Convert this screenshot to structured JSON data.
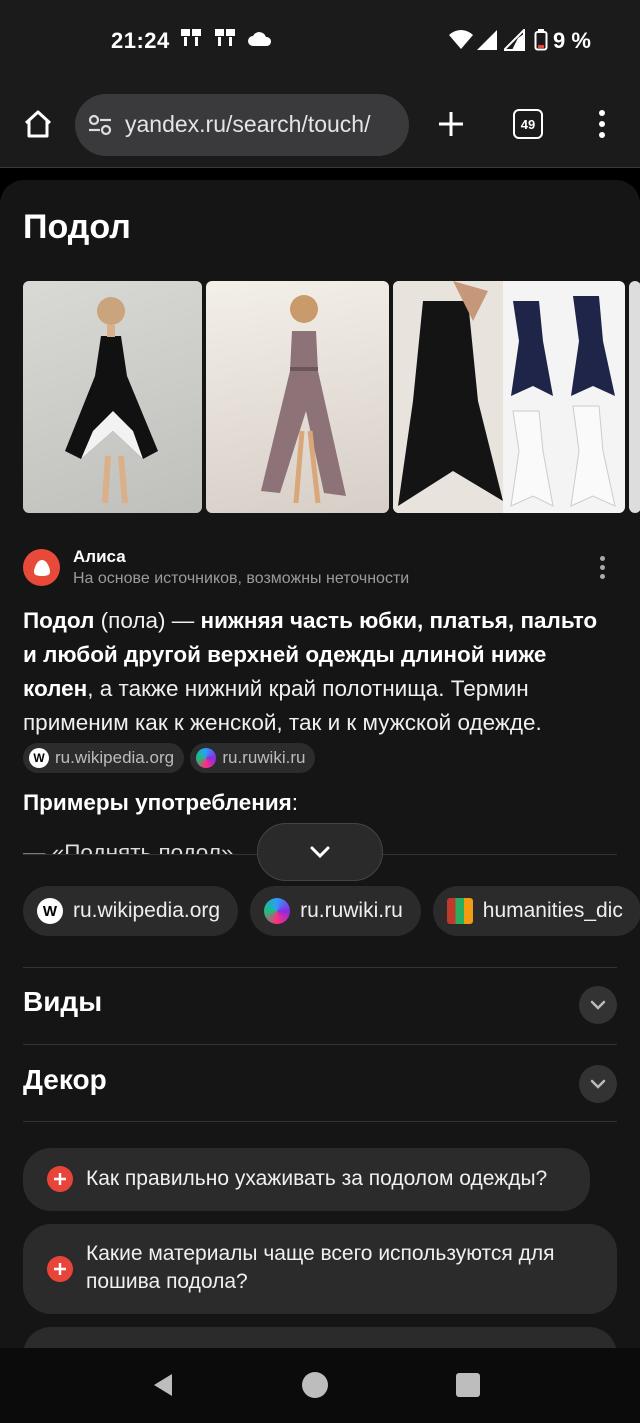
{
  "status_bar": {
    "time": "21:24",
    "battery": "9 %"
  },
  "browser": {
    "url": "yandex.ru/search/touch/",
    "tab_count": "49"
  },
  "page": {
    "title": "Подол"
  },
  "alice": {
    "name": "Алиса",
    "subtitle": "На основе источников, возможны неточности",
    "answer_bold_1": "Подол",
    "answer_plain_1": " (пола) — ",
    "answer_bold_2": "нижняя часть юбки, платья, пальто и любой другой верхней одежды длиной ниже колен",
    "answer_plain_2": ", а также нижний край полотнища. Термин применим как к женской, так и к мужской одежде. ",
    "inline_sources": [
      "ru.wikipedia.org",
      "ru.ruwiki.ru"
    ],
    "examples_label": "Примеры употребления",
    "examples_colon": ":",
    "example_first": "— «Поднять подол»"
  },
  "sources": [
    {
      "label": "ru.wikipedia.org",
      "icon": "wikipedia-icon"
    },
    {
      "label": "ru.ruwiki.ru",
      "icon": "ruwiki-icon"
    },
    {
      "label": "humanities_dic",
      "icon": "book-icon"
    }
  ],
  "sections": [
    {
      "title": "Виды"
    },
    {
      "title": "Декор"
    }
  ],
  "questions": [
    {
      "text": "Как правильно ухаживать за подолом одежды?"
    },
    {
      "text": "Какие материалы чаще всего используются для пошива подола?"
    }
  ],
  "colors": {
    "accent_red": "#e8443a",
    "background": "#151515",
    "card": "#2b2b2b"
  }
}
